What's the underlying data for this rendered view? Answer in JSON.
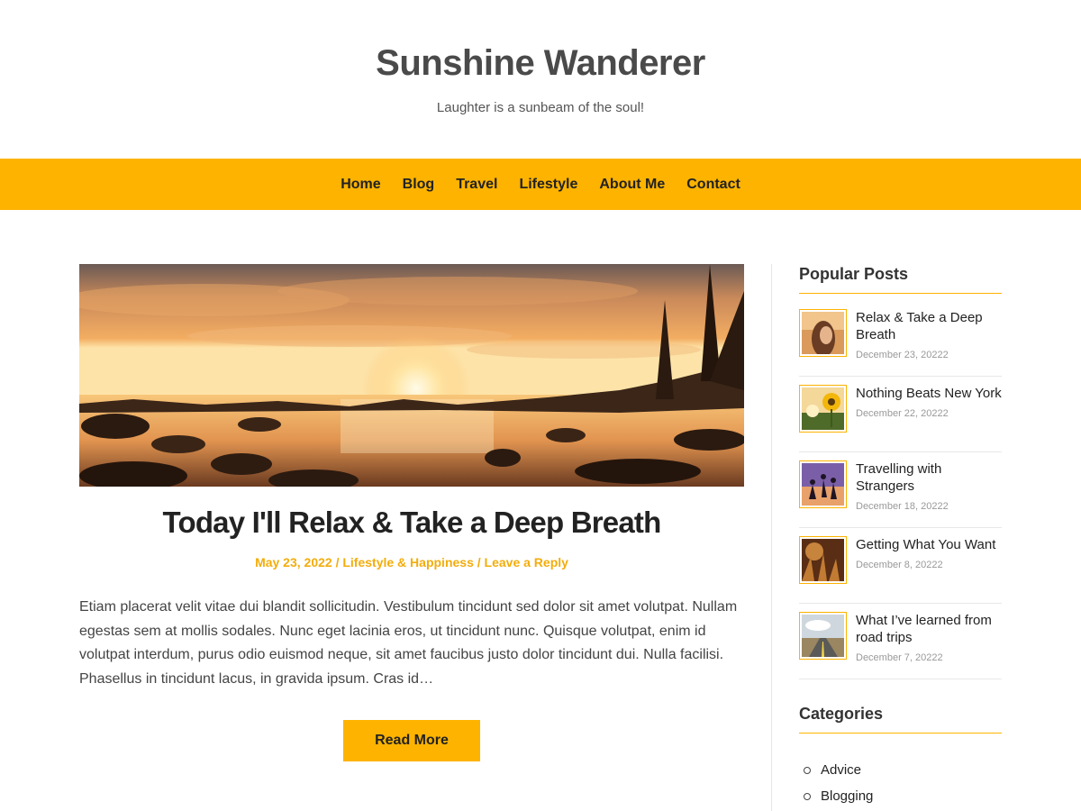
{
  "site": {
    "title": "Sunshine Wanderer",
    "tagline": "Laughter is a sunbeam of the soul!"
  },
  "nav": {
    "items": [
      "Home",
      "Blog",
      "Travel",
      "Lifestyle",
      "About Me",
      "Contact"
    ]
  },
  "post": {
    "title": "Today I'll Relax & Take a Deep Breath",
    "date": "May 23, 2022",
    "separator": "/",
    "category": "Lifestyle & Happiness",
    "reply": "Leave a Reply",
    "excerpt": "Etiam placerat velit vitae dui blandit sollicitudin. Vestibulum tincidunt sed dolor sit amet volutpat. Nullam egestas sem at mollis sodales. Nunc eget lacinia eros, ut tincidunt nunc. Quisque volutpat, enim id volutpat interdum, purus odio euismod neque, sit amet faucibus justo dolor tincidunt dui. Nulla facilisi. Phasellus in tincidunt lacus, in gravida ipsum. Cras id…",
    "read_more": "Read More"
  },
  "sidebar": {
    "popular_title": "Popular Posts",
    "popular": [
      {
        "title": "Relax & Take a Deep Breath",
        "date": "December 23, 20222"
      },
      {
        "title": "Nothing Beats New York",
        "date": "December 22, 20222"
      },
      {
        "title": "Travelling with Strangers",
        "date": "December 18, 20222"
      },
      {
        "title": "Getting What You Want",
        "date": "December 8, 20222"
      },
      {
        "title": "What I’ve learned from road trips",
        "date": "December 7, 20222"
      }
    ],
    "categories_title": "Categories",
    "categories": [
      "Advice",
      "Blogging"
    ]
  },
  "colors": {
    "accent": "#fdb300",
    "meta_text": "#f3ad0b"
  }
}
